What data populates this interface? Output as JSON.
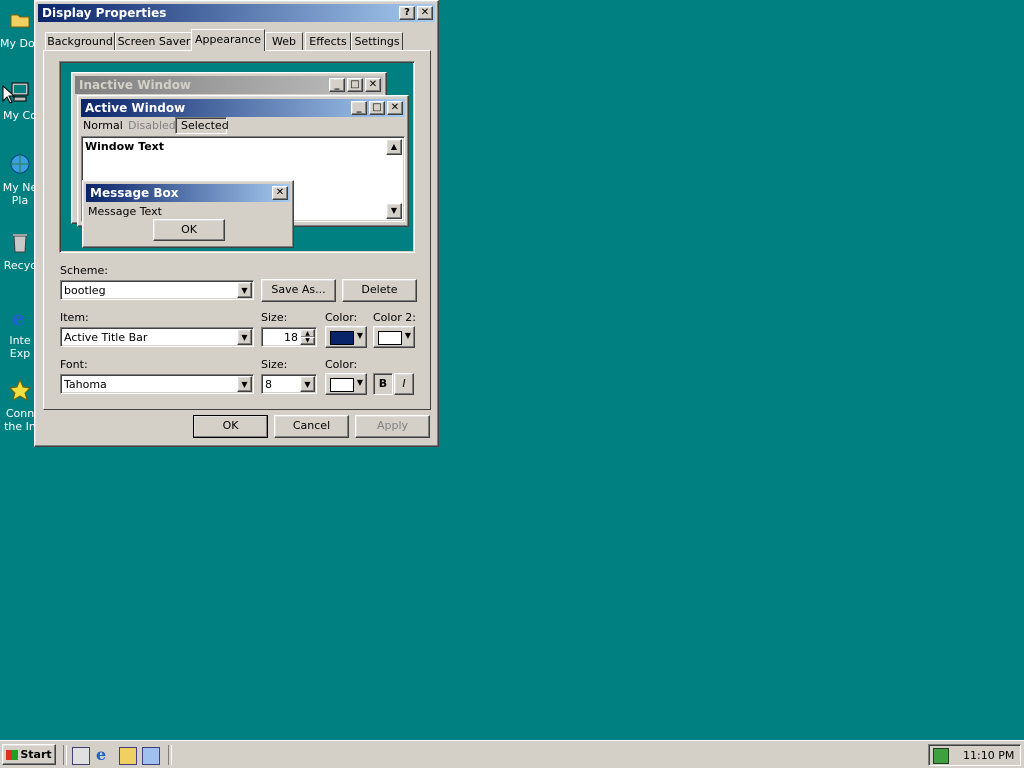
{
  "desktop": {
    "icons": [
      {
        "label": "My Doc",
        "icon": "folder-icon"
      },
      {
        "label": "My Co",
        "icon": "computer-icon"
      },
      {
        "label": "My Ne",
        "label2": "Pla",
        "icon": "network-icon"
      },
      {
        "label": "Recyc",
        "icon": "recycle-bin-icon"
      },
      {
        "label": "Inte",
        "label2": "Exp",
        "icon": "internet-explorer-icon"
      },
      {
        "label": "Conn",
        "label2": "the In",
        "icon": "connect-icon"
      }
    ],
    "background_color": "#008080"
  },
  "dialog": {
    "title": "Display Properties",
    "help_btn": "?",
    "close_btn": "✕",
    "tabs": [
      "Background",
      "Screen Saver",
      "Appearance",
      "Web",
      "Effects",
      "Settings"
    ],
    "selected_tab": "Appearance",
    "preview": {
      "inactive_title": "Inactive Window",
      "active_title": "Active Window",
      "menu": [
        "Normal",
        "Disabled",
        "Selected"
      ],
      "window_text": "Window Text",
      "msgbox_title": "Message Box",
      "msgbox_text": "Message Text",
      "msgbox_ok": "OK"
    },
    "scheme_label": "Scheme:",
    "scheme_value": "bootleg",
    "save_as": "Save As...",
    "delete": "Delete",
    "item_label": "Item:",
    "item_value": "Active Title Bar",
    "size_label": "Size:",
    "size_value": "18",
    "color_label": "Color:",
    "color2_label": "Color 2:",
    "color_value": "#0a246a",
    "color2_value": "#ffffff",
    "font_label": "Font:",
    "font_value": "Tahoma",
    "font_size_label": "Size:",
    "font_size_value": "8",
    "font_color_label": "Color:",
    "font_color_value": "#ffffff",
    "bold_btn": "B",
    "italic_btn": "I",
    "ok": "OK",
    "cancel": "Cancel",
    "apply": "Apply"
  },
  "taskbar": {
    "start": "Start",
    "quicklaunch": [
      "desktop-icon",
      "ie-icon",
      "outlook-icon",
      "explorer-icon"
    ],
    "clock": "11:10 PM"
  }
}
